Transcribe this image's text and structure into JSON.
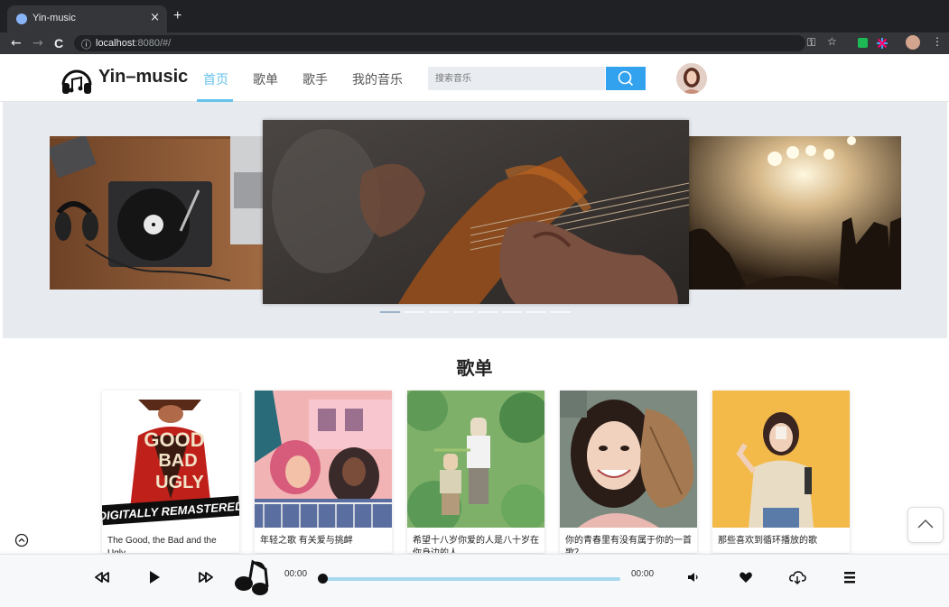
{
  "browser": {
    "tab_title": "Yin-music",
    "tab_close": "×",
    "new_tab": "+",
    "url_host": "localhost",
    "url_rest": ":8080/#/",
    "back": "←",
    "forward": "→",
    "reload": "C",
    "info_icon": "ⓘ",
    "key_icon": "⚿",
    "star_icon": "☆",
    "menu_icon": "⋮"
  },
  "header": {
    "logo_text": "Yin–music",
    "nav": [
      {
        "label": "首页",
        "active": true
      },
      {
        "label": "歌单",
        "active": false
      },
      {
        "label": "歌手",
        "active": false
      },
      {
        "label": "我的音乐",
        "active": false
      }
    ],
    "search_placeholder": "搜索音乐"
  },
  "carousel": {
    "indicator_count": 8,
    "active_index": 0
  },
  "playlists": {
    "title": "歌单",
    "items": [
      {
        "title": "The Good, the Bad and the Ugly"
      },
      {
        "title": "年轻之歌 有关爱与挑衅"
      },
      {
        "title": "希望十八岁你爱的人是八十岁在你身边的人"
      },
      {
        "title": "你的青春里有没有属于你的一首歌？"
      },
      {
        "title": "那些喜欢到循环播放的歌"
      }
    ],
    "cover1_overlay": "DIGITALLY REMASTERED",
    "cover1_words": [
      "GOOD",
      "BAD",
      "UGLY"
    ]
  },
  "player": {
    "current_time": "00:00",
    "total_time": "00:00",
    "progress": 0
  },
  "colors": {
    "accent": "#67c2ec",
    "search_button": "#32a2ef"
  }
}
